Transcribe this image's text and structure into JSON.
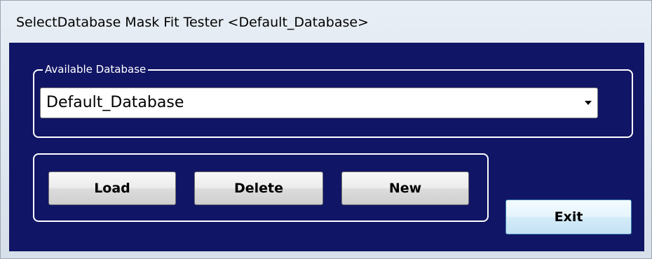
{
  "window": {
    "title": "SelectDatabase Mask Fit Tester <Default_Database>"
  },
  "database_group": {
    "legend": "Available Database",
    "selected": "Default_Database",
    "icon": "chevron-down-icon"
  },
  "actions": {
    "load_label": "Load",
    "delete_label": "Delete",
    "new_label": "New"
  },
  "exit_label": "Exit",
  "colors": {
    "client_background": "#111565",
    "group_border": "#ffffff"
  }
}
